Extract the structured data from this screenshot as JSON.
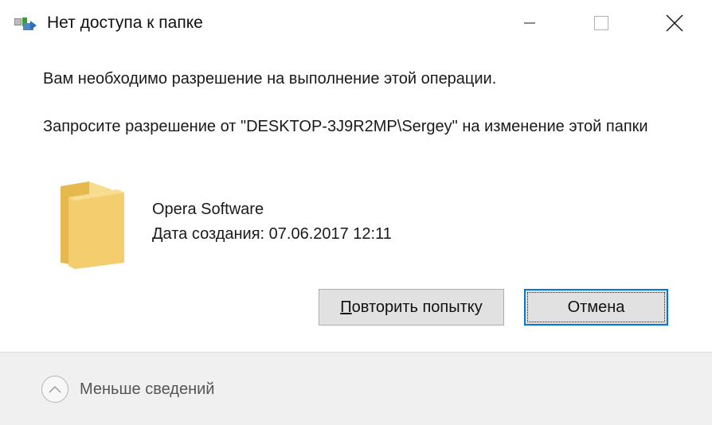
{
  "dialog": {
    "title": "Нет доступа к папке",
    "message_permission": "Вам необходимо разрешение на выполнение этой операции.",
    "message_request": "Запросите разрешение от \"DESKTOP-3J9R2MP\\Sergey\" на изменение этой папки"
  },
  "item": {
    "name": "Opera Software",
    "date_created": "Дата создания: 07.06.2017 12:11",
    "icon": "folder-icon"
  },
  "buttons": {
    "retry_hotkey": "П",
    "retry_rest": "овторить попытку",
    "cancel_label": "Отмена"
  },
  "footer": {
    "toggle_label": "Меньше сведений",
    "toggle_icon": "chevron-up-icon"
  },
  "window_controls": {
    "minimize_icon": "minimize-icon",
    "maximize_icon": "maximize-icon",
    "close_icon": "close-icon"
  },
  "colors": {
    "accent": "#0078d7",
    "folder": "#f3cd6e"
  }
}
